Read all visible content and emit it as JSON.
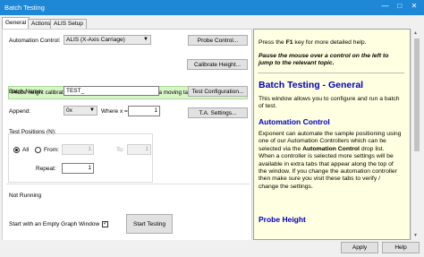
{
  "window": {
    "title": "Batch Testing",
    "minimize": "—",
    "maximize": "□",
    "close": "✕"
  },
  "tabs": [
    "General",
    "Actions",
    "ALIS Setup"
  ],
  "form": {
    "automation_control_label": "Automation Control:",
    "automation_control_value": "ALIS (X-Axis Carriage)",
    "probe_control_button": "Probe Control...",
    "banner_text": "Probe height calibration is essential for safe operation with a moving table:",
    "calibrate_button": "Calibrate Height...",
    "batch_name_label": "Batch Name:",
    "batch_name_value": "TEST_",
    "test_config_button": "Test Configuration...",
    "append_label": "Append:",
    "append_value": "0x",
    "where_label": "Where x =",
    "where_value": "1",
    "ta_settings_button": "T.A. Settings...",
    "test_positions_label": "Test Positions (N):",
    "all_label": "All",
    "from_label": "From:",
    "from_value": "1",
    "to_label": "To:",
    "to_value": "1",
    "repeat_label": "Repeat:",
    "repeat_value": "1",
    "status_text": "Not Running",
    "start_empty_label": "Start with an Empty Graph Window",
    "start_empty_checked": "✓",
    "start_testing_button": "Start Testing"
  },
  "help": {
    "line1": "Press the F1 key for more detailed help.",
    "line2": "Pause the mouse over a control on the left to jump to the relevant topic.",
    "title": "Batch Testing - General",
    "intro": "This window allows you to configure and run a batch of test.",
    "section1_heading": "Automation Control",
    "section1_text_a": "Exponent can automate the sample positioning using one of our Automation Controllers which can be selected via the ",
    "section1_text_bold": "Automation Control",
    "section1_text_b": " drop list. When a controller is selected more settings will be available in extra tabs that appear along the top of the window. If you change the automation controller then make sure you visit these tabs to verify / change the settings.",
    "section2_heading": "Probe Height"
  },
  "footer": {
    "apply_button": "Apply",
    "help_button": "Help"
  },
  "colors": {
    "titlebar": "#1e88d6",
    "help_bg": "#ffffe1",
    "help_heading": "#0000c0",
    "banner_bg": "#d8f5c8"
  }
}
